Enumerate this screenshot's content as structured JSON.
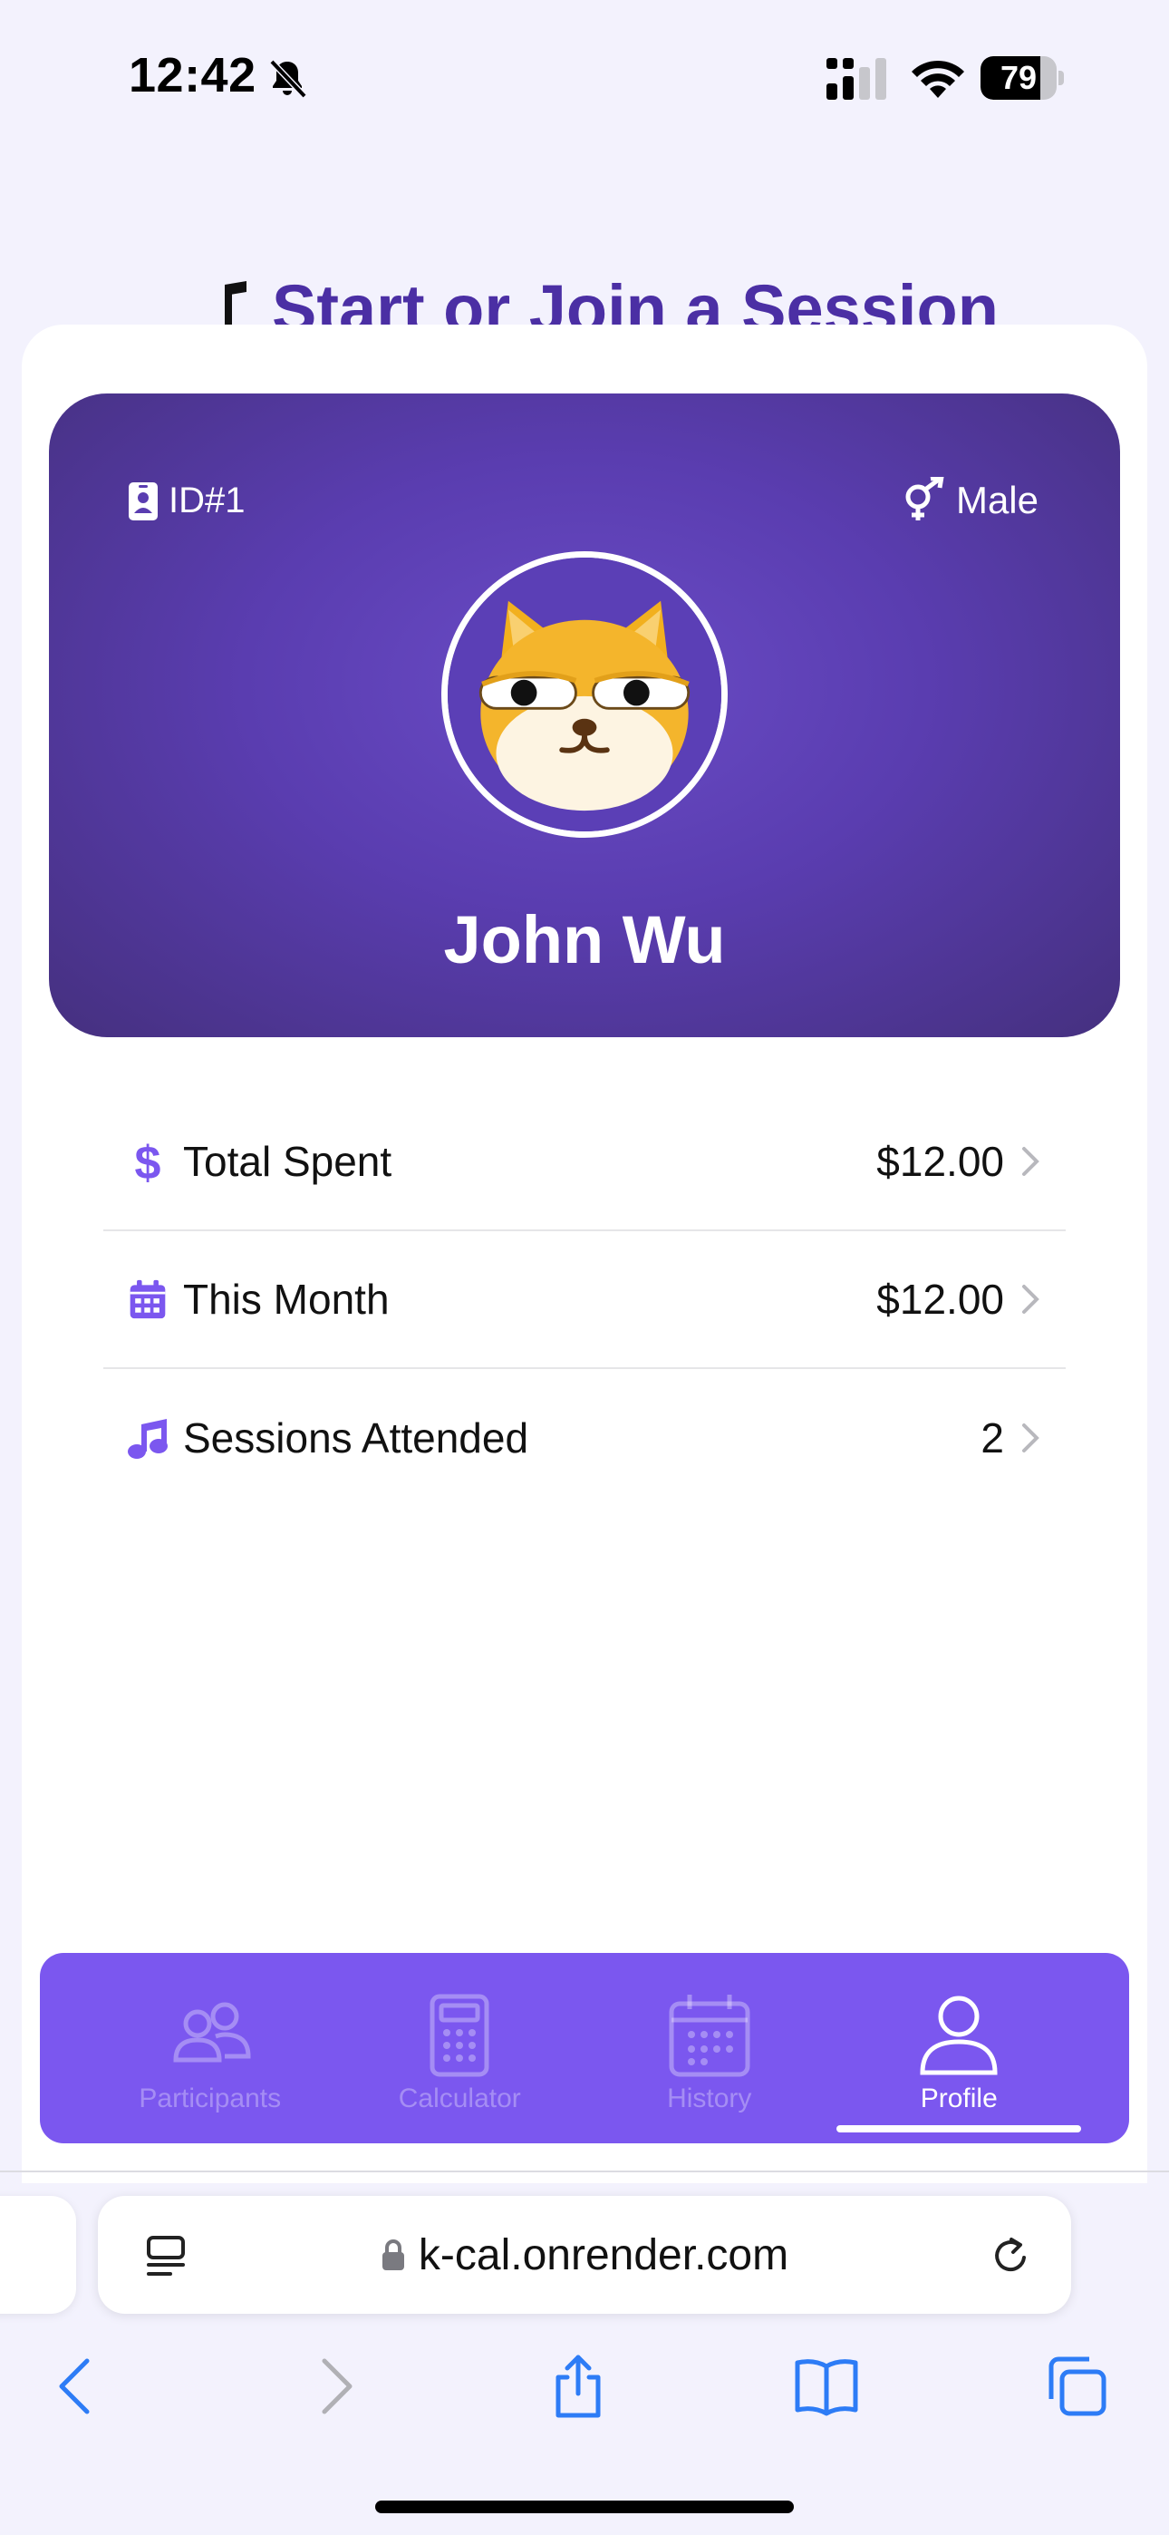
{
  "status_bar": {
    "time": "12:42",
    "battery": "79",
    "battery_level": 0.79
  },
  "behind_page": {
    "title": "Start or Join a Session"
  },
  "profile": {
    "id_label": "ID#1",
    "gender": "Male",
    "name": "John Wu",
    "avatar_icon": "shiba-dog-emoji"
  },
  "stats": [
    {
      "label": "Total Spent",
      "value": "$12.00",
      "icon": "dollar-icon"
    },
    {
      "label": "This Month",
      "value": "$12.00",
      "icon": "calendar-icon"
    },
    {
      "label": "Sessions Attended",
      "value": "2",
      "icon": "music-note-icon"
    }
  ],
  "tabs": [
    {
      "label": "Participants",
      "icon": "users-icon",
      "active": false
    },
    {
      "label": "Calculator",
      "icon": "calculator-icon",
      "active": false
    },
    {
      "label": "History",
      "icon": "calendar-icon",
      "active": false
    },
    {
      "label": "Profile",
      "icon": "user-icon",
      "active": true
    }
  ],
  "browser": {
    "url": "k-cal.onrender.com"
  },
  "colors": {
    "accent": "#7b57ef",
    "card": "#5a3db0",
    "icon_purple": "#7b57ef"
  }
}
